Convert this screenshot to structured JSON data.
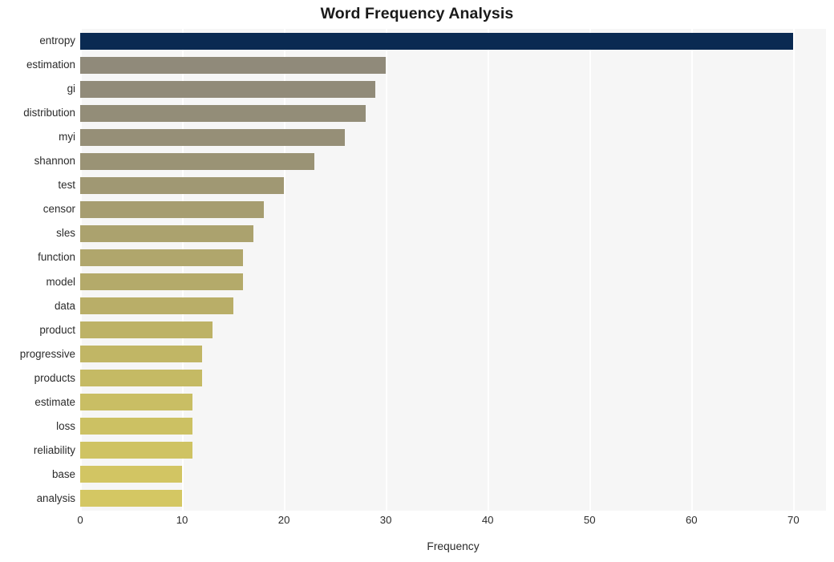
{
  "chart_data": {
    "type": "bar",
    "orientation": "horizontal",
    "title": "Word Frequency Analysis",
    "xlabel": "Frequency",
    "ylabel": "",
    "xlim": [
      0,
      73.2
    ],
    "xticks": [
      0,
      10,
      20,
      30,
      40,
      50,
      60,
      70
    ],
    "xtick_labels": [
      "0",
      "10",
      "20",
      "30",
      "40",
      "50",
      "60",
      "70"
    ],
    "grid": "vertical-white-on-light-gray",
    "legend": "none",
    "categories": [
      "entropy",
      "estimation",
      "gi",
      "distribution",
      "myi",
      "shannon",
      "test",
      "censor",
      "sles",
      "function",
      "model",
      "data",
      "product",
      "progressive",
      "products",
      "estimate",
      "loss",
      "reliability",
      "base",
      "analysis"
    ],
    "values": [
      70,
      30,
      29,
      28,
      26,
      23,
      20,
      18,
      17,
      16,
      16,
      15,
      13,
      12,
      12,
      11,
      11,
      11,
      10,
      10
    ],
    "bar_colors": [
      "#0a2a52",
      "#908a7a",
      "#918b79",
      "#938d78",
      "#968f77",
      "#9a9375",
      "#a09873",
      "#a69d70",
      "#aba26e",
      "#b0a66c",
      "#b4aa6a",
      "#b9ae68",
      "#bdb266",
      "#c1b665",
      "#c5ba64",
      "#c9be64",
      "#ccc163",
      "#cfc363",
      "#d2c563",
      "#d4c763"
    ],
    "plot_background": "#f6f6f6",
    "gridline_color": "#ffffff",
    "page_background": "#ffffff",
    "text_color": "#2b2b2b"
  }
}
